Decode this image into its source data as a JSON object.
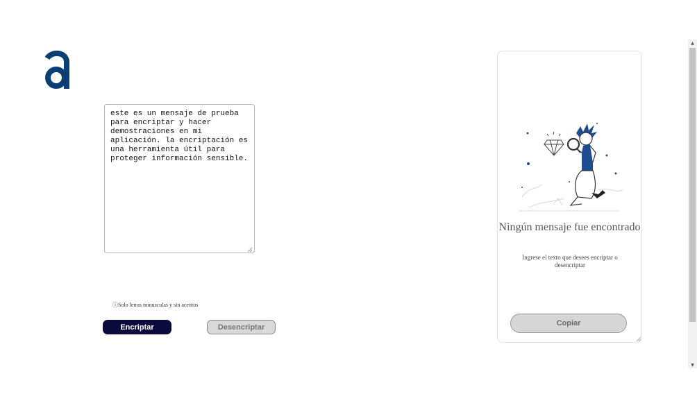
{
  "brand": {
    "logo_icon": "letter-a-logo",
    "color": "#0b3f73"
  },
  "input": {
    "text": "este es un mensaje de prueba para encriptar y hacer demostraciones en mi aplicación. la encriptación es una herramienta útil para proteger información sensible."
  },
  "notice": {
    "icon": "info-circle-icon",
    "glyph": "ⓘ",
    "text": "Solo letras minusculas y sin acentos"
  },
  "buttons": {
    "encrypt_label": "Encriptar",
    "decrypt_label": "Desencriptar",
    "copy_label": "Copiar"
  },
  "output": {
    "illustration": "person-with-magnifying-glass-diamond-illustration",
    "title": "Ningún mensaje fue encontrado",
    "subtitle": "Ingrese el texto que desees encriptar o desencriptar"
  },
  "colors": {
    "primary": "#0a0a3c",
    "secondary_button": "#d9d9d9",
    "illustration_blue": "#1e4d8f"
  }
}
